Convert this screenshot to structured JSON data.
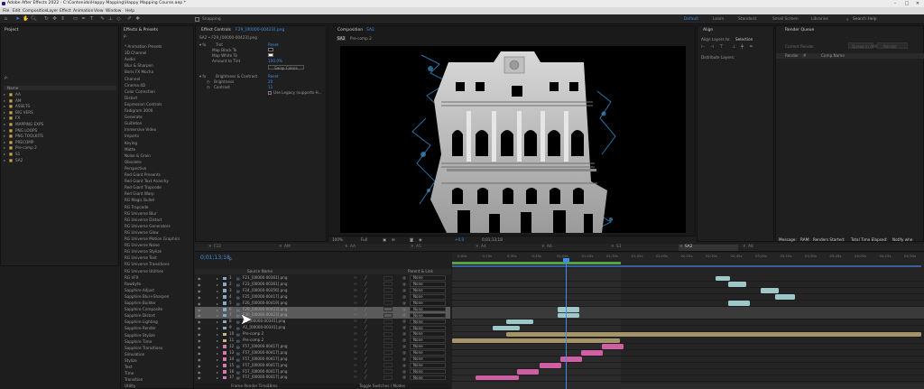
{
  "app": {
    "title": "Adobe After Effects 2022 - C:\\Contenido\\Happy Mapping\\Happy Mapping Course.aep *",
    "window_controls": [
      "–",
      "□",
      "✕"
    ]
  },
  "menu": [
    "File",
    "Edit",
    "Composition",
    "Layer",
    "Effect",
    "Animation",
    "View",
    "Window",
    "Help"
  ],
  "toolbar": {
    "snapping_label": "Snapping",
    "workspaces": [
      "Default",
      "Learn",
      "Standard",
      "Small Screen",
      "Libraries"
    ],
    "active_workspace": "Default",
    "search_placeholder": "Search Help"
  },
  "project_panel": {
    "title": "Project",
    "search_prefix": "ρ.",
    "column_header": "Name",
    "items": [
      "AA",
      "AM",
      "ASSETS",
      "BIG VERS",
      "FX",
      "MAPPING EXPS",
      "PNG LOOPS",
      "PNG TOOLKITS",
      "PRECOMP",
      "Pre-comp 2",
      "S1",
      "SA2"
    ]
  },
  "effects_panel": {
    "title": "Effects & Presets",
    "search_prefix": "ρ.",
    "items": [
      "* Animation Presets",
      "3D Channel",
      "Audio",
      "Blur & Sharpen",
      "Boris FX Mocha",
      "Channel",
      "Cinema 4D",
      "Color Correction",
      "Distort",
      "Expression Controls",
      "Fadigram 3000",
      "Generate",
      "Guitleton",
      "Immersive Video",
      "Imports",
      "Keying",
      "Matte",
      "Noise & Grain",
      "Obsolete",
      "Perspective",
      "Red Giant Presents",
      "Red Giant Text Anarchy",
      "Red Giant Trapcode",
      "Red Giant Warp",
      "RG Magic Bullet",
      "RG Trapcode",
      "RG Universe Blur",
      "RG Universe Distort",
      "RG Universe Generators",
      "RG Universe Glow",
      "RG Universe Motion Graphics",
      "RG Universe Noise",
      "RG Universe Stylize",
      "RG Universe Text",
      "RG Universe Transitions",
      "RG Universe Utilities",
      "RG VFX",
      "Rowbyte",
      "Sapphire Adjust",
      "Sapphire Blur+Sharpen",
      "Sapphire Builder",
      "Sapphire Composite",
      "Sapphire Distort",
      "Sapphire Lighting",
      "Sapphire Render",
      "Sapphire Stylize",
      "Sapphire Time",
      "Sapphire Transitions",
      "Simulation",
      "Stylize",
      "Text",
      "Time",
      "Transition",
      "Utility"
    ]
  },
  "effect_controls": {
    "title": "Effect Controls",
    "layer_name": "F29_[00000-00423].png",
    "breadcrumb": "SA2 • F29_[00000-00423].png",
    "effects": [
      {
        "name": "Tint",
        "reset": "Reset",
        "params": [
          "Map Black To",
          "Map White To",
          "Amount to Tint"
        ],
        "amount_value": "100.0%",
        "swap_button": "Swap Colors"
      },
      {
        "name": "Brightness & Contrast",
        "reset": "Reset",
        "params": [
          "Brightness",
          "Contrast"
        ],
        "values": [
          "20",
          "11"
        ],
        "legacy_label": "Use Legacy (supports H..."
      }
    ]
  },
  "composition": {
    "title": "Composition",
    "comp_name": "SA2",
    "breadcrumb_items": [
      "SA2",
      "Pre-comp 2"
    ],
    "zoom": "100%",
    "resolution": "Full",
    "timecode": "0;01;13;18",
    "color_value": "+0.0"
  },
  "align_panel": {
    "title": "Align",
    "align_layers_to_label": "Align Layers to:",
    "align_target": "Selection",
    "distribute_label": "Distribute Layers:"
  },
  "render_queue": {
    "title": "Render Queue",
    "current_render_label": "Current Render",
    "render_button": "Render",
    "queue_in_ame": "Queue in AME",
    "columns": [
      "Render",
      "#",
      "Comp Name"
    ],
    "status": {
      "message_label": "Message:",
      "ram_label": "RAM:",
      "renders_started_label": "Renders Started:",
      "total_time_label": "Total Time Elapsed:",
      "notify_label": "Notify whe"
    }
  },
  "comp_tabs": [
    "F22",
    "AM",
    "AA",
    "A5",
    "A4",
    "A6",
    "S3",
    "SA2",
    "A8"
  ],
  "active_comp_tab": "SA2",
  "timeline": {
    "timecode": "0;01;13;18",
    "search_prefix": "ρ.",
    "source_name_header": "Source Name",
    "parent_header": "Parent & Link",
    "ruler": [
      "0;00s",
      "0;15s",
      "0;30s",
      "0;45s",
      "01;00s",
      "01;15s",
      "01;30s",
      "01;45s",
      "02;00s",
      "02;15s",
      "02;30s",
      "02;45s",
      "03;00s",
      "03;15s",
      "03;30s",
      "03;45s",
      "04;00s",
      "04;15s",
      "04;30s"
    ],
    "layers": [
      {
        "num": "1",
        "name": "F21_[00000-00361].png",
        "parent": "None",
        "color": "#8aa8c4"
      },
      {
        "num": "2",
        "name": "F23_[00000-00361].png",
        "parent": "None",
        "color": "#8aa8c4"
      },
      {
        "num": "3",
        "name": "F24_[00000-00356].png",
        "parent": "None",
        "color": "#8aa8c4"
      },
      {
        "num": "4",
        "name": "F25_[00000-00417].png",
        "parent": "None",
        "color": "#8aa8c4"
      },
      {
        "num": "5",
        "name": "F26_[00000-00419].png",
        "parent": "None",
        "color": "#8aa8c4"
      },
      {
        "num": "6",
        "name": "F29_[00000-00423].png",
        "parent": "None",
        "color": "#8aa8c4",
        "selected": true
      },
      {
        "num": "7",
        "name": "F30_[00000-00423].png",
        "parent": "None",
        "color": "#8aa8c4",
        "selected": true
      },
      {
        "num": "8",
        "name": "B1_[00000-00341].png",
        "parent": "None",
        "color": "#8aa8c4"
      },
      {
        "num": "9",
        "name": "A1_[00000-00341].png",
        "parent": "None",
        "color": "#8aa8c4"
      },
      {
        "num": "10",
        "name": "Pre-comp 2",
        "parent": "None",
        "color": "#c8b48a"
      },
      {
        "num": "11",
        "name": "Pre-comp 2",
        "parent": "None",
        "color": "#c8b48a"
      },
      {
        "num": "12",
        "name": "F57_[00000-00417].png",
        "parent": "None",
        "color": "#d478b0"
      },
      {
        "num": "13",
        "name": "F57_[00000-00417].png",
        "parent": "None",
        "color": "#d478b0"
      },
      {
        "num": "14",
        "name": "F57_[00000-00417].png",
        "parent": "None",
        "color": "#d478b0"
      },
      {
        "num": "15",
        "name": "F57_[00000-00417].png",
        "parent": "None",
        "color": "#d478b0"
      },
      {
        "num": "16",
        "name": "F57_[00000-00417].png",
        "parent": "None",
        "color": "#d478b0"
      },
      {
        "num": "17",
        "name": "F57_[00000-00417].png",
        "parent": "None",
        "color": "#d478b0"
      }
    ],
    "footer": {
      "render_time_label": "Frame Render Time:",
      "render_time_value": "18ms",
      "toggle_label": "Toggle Switches / Modes"
    }
  },
  "colors": {
    "accent": "#3d8fe6",
    "layer_selected": "#5a5a5a",
    "bar_blue": "#9ec8c8",
    "bar_tan": "#a5946a",
    "bar_pink": "#cf5fa3"
  }
}
